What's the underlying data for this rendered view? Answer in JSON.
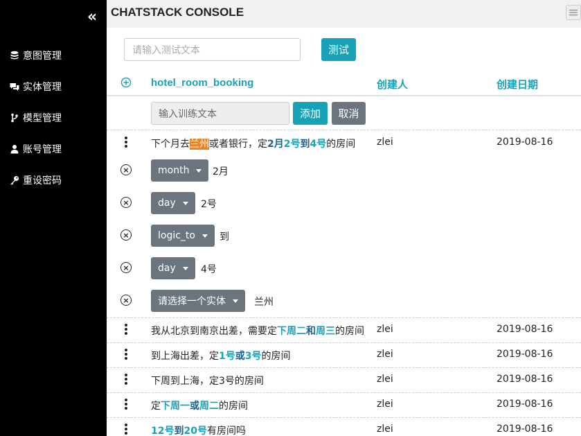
{
  "sidebar": {
    "collapse_glyph": "«",
    "items": [
      {
        "label": "意图管理",
        "icon": "database-icon"
      },
      {
        "label": "实体管理",
        "icon": "comments-icon"
      },
      {
        "label": "模型管理",
        "icon": "branch-icon"
      },
      {
        "label": "账号管理",
        "icon": "user-icon"
      },
      {
        "label": "重设密码",
        "icon": "key-icon"
      }
    ]
  },
  "header": {
    "title": "CHATSTACK CONSOLE"
  },
  "test": {
    "placeholder": "请输入测试文本",
    "button": "测试"
  },
  "table": {
    "intent_name": "hotel_room_booking",
    "col_creator": "创建人",
    "col_date": "创建日期",
    "train_placeholder": "输入训练文本",
    "add_button": "添加",
    "cancel_button": "取消"
  },
  "rows": [
    {
      "parts": [
        {
          "text": "下个月去",
          "style": "plain"
        },
        {
          "text": "兰州",
          "style": "orange"
        },
        {
          "text": "或者银行，定",
          "style": "plain"
        },
        {
          "text": "2月",
          "style": "teal"
        },
        {
          "text": "2号",
          "style": "teal"
        },
        {
          "text": "到",
          "style": "teal"
        },
        {
          "text": "4号",
          "style": "teal"
        },
        {
          "text": "的房间",
          "style": "plain"
        }
      ],
      "creator": "zlei",
      "date": "2019-08-16"
    },
    {
      "parts": [
        {
          "text": "我从北京到南京出差，需要定",
          "style": "plain"
        },
        {
          "text": "下周二",
          "style": "teal"
        },
        {
          "text": "和",
          "style": "teal"
        },
        {
          "text": "周三",
          "style": "teal"
        },
        {
          "text": "的房间",
          "style": "plain"
        }
      ],
      "creator": "zlei",
      "date": "2019-08-16"
    },
    {
      "parts": [
        {
          "text": "到上海出差，定",
          "style": "plain"
        },
        {
          "text": "1号",
          "style": "teal"
        },
        {
          "text": "或",
          "style": "teal"
        },
        {
          "text": "3号",
          "style": "teal"
        },
        {
          "text": "的房间",
          "style": "plain"
        }
      ],
      "creator": "zlei",
      "date": "2019-08-16"
    },
    {
      "parts": [
        {
          "text": "下周到上海，定3号的房间",
          "style": "plain"
        }
      ],
      "creator": "zlei",
      "date": "2019-08-16"
    },
    {
      "parts": [
        {
          "text": "定",
          "style": "plain"
        },
        {
          "text": "下周一",
          "style": "teal"
        },
        {
          "text": "或",
          "style": "teal"
        },
        {
          "text": "周二",
          "style": "teal"
        },
        {
          "text": "的房间",
          "style": "plain"
        }
      ],
      "creator": "zlei",
      "date": "2019-08-16"
    },
    {
      "parts": [
        {
          "text": "12号",
          "style": "teal"
        },
        {
          "text": "到",
          "style": "teal"
        },
        {
          "text": "20号",
          "style": "teal"
        },
        {
          "text": "有房间吗",
          "style": "plain"
        }
      ],
      "creator": "zlei",
      "date": "2019-08-16"
    }
  ],
  "entities": [
    {
      "type": "month",
      "value": "2月"
    },
    {
      "type": "day",
      "value": "2号"
    },
    {
      "type": "logic_to",
      "value": "到"
    },
    {
      "type": "day",
      "value": "4号"
    },
    {
      "type": "请选择一个实体",
      "value": "兰州"
    }
  ],
  "colors": {
    "accent": "#17a2b8",
    "secondary": "#6c757d",
    "highlight": "#e8832b",
    "sidebar": "#000000"
  }
}
